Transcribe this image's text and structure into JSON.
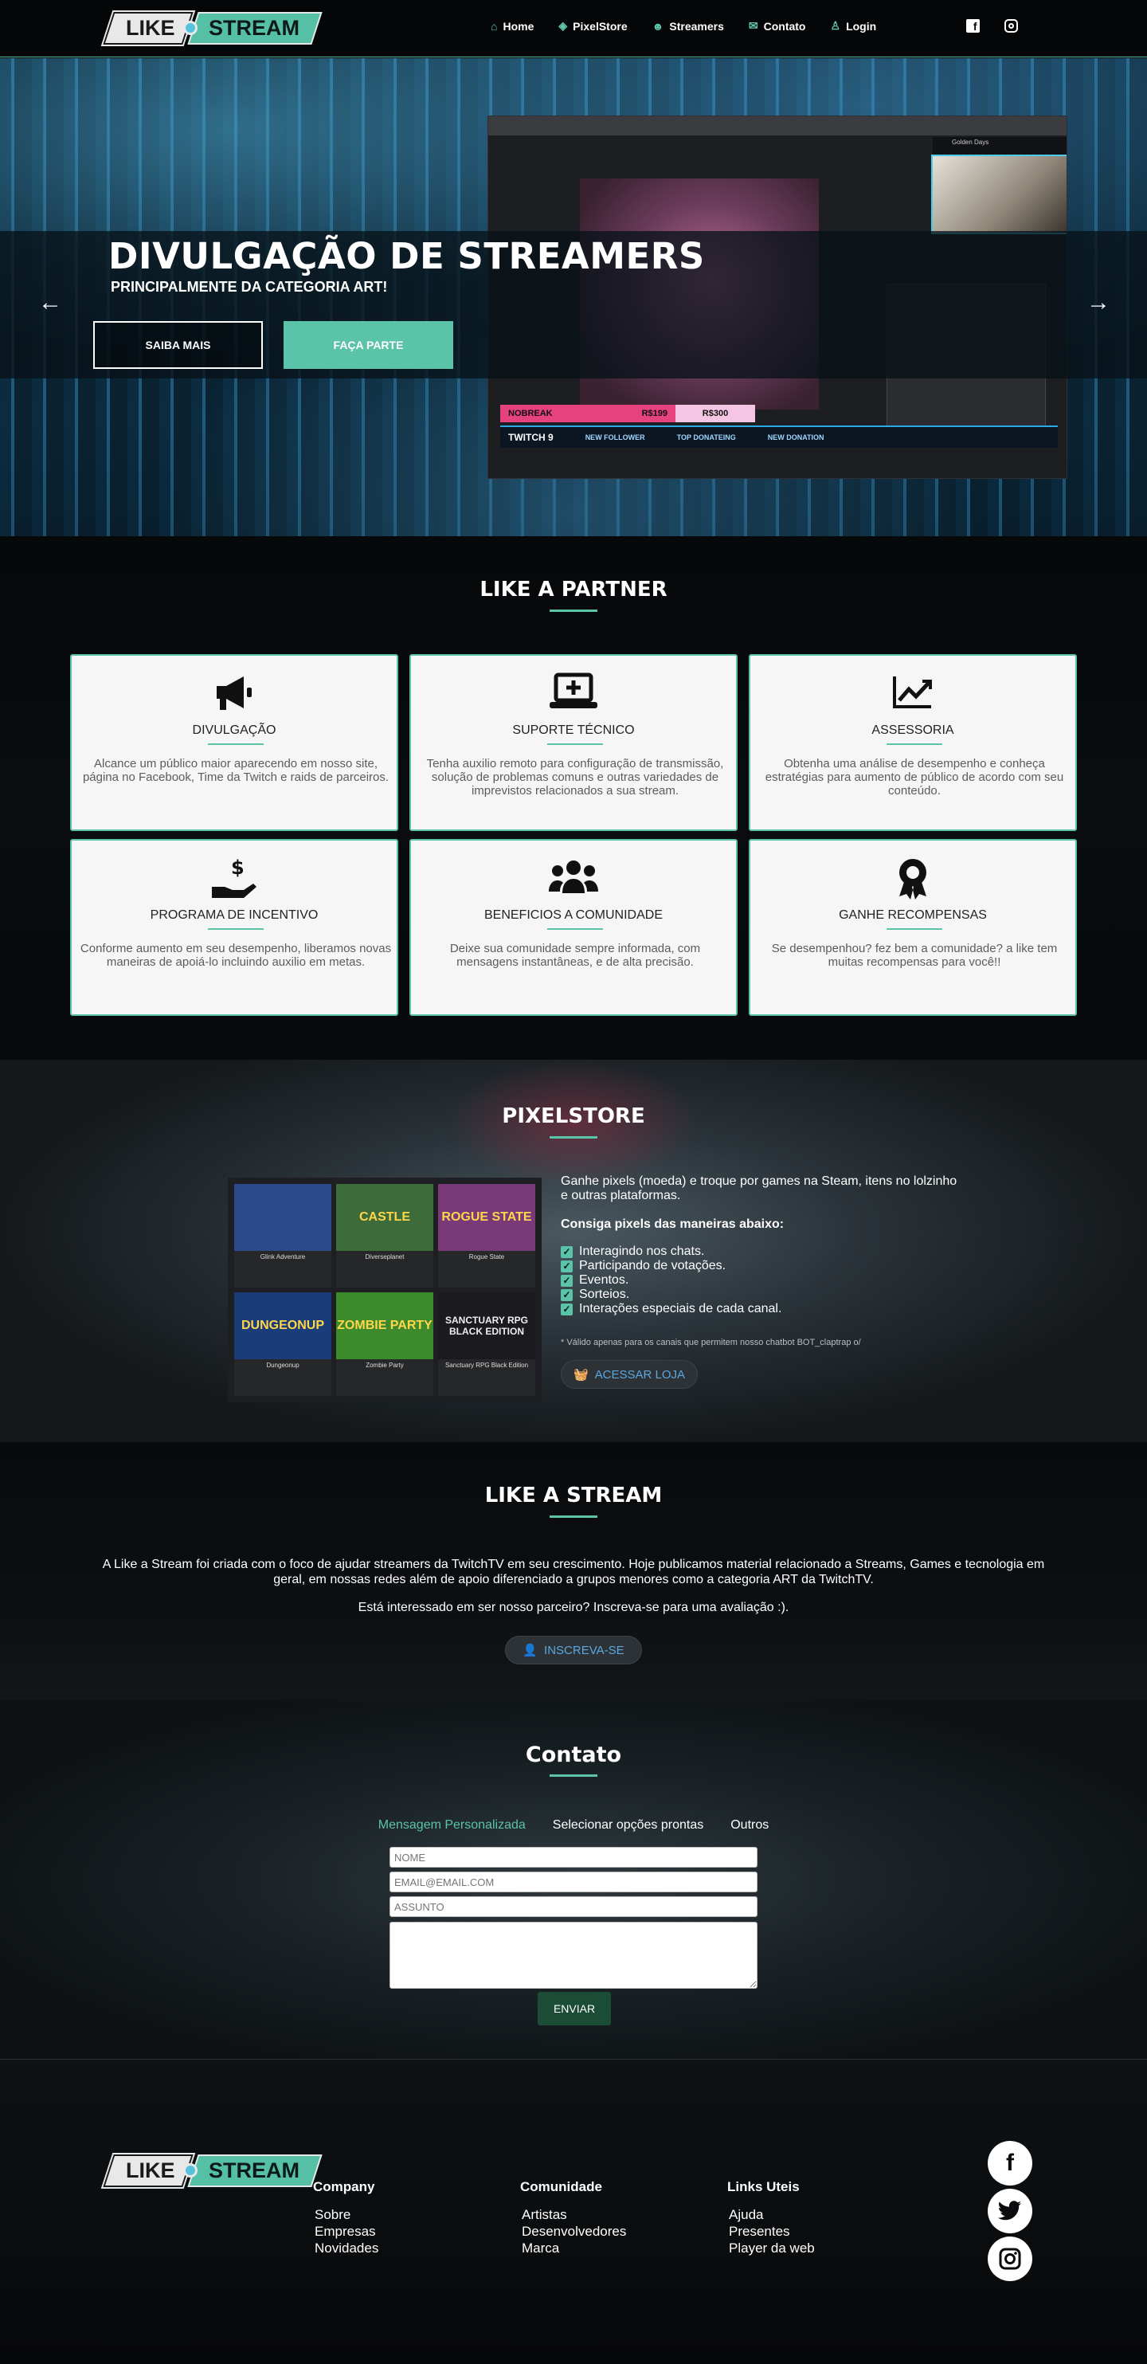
{
  "nav": {
    "logo_like": "LIKE",
    "logo_stream": "STREAM",
    "links": [
      {
        "label": "Home",
        "icon": "home-icon"
      },
      {
        "label": "PixelStore",
        "icon": "coins-icon"
      },
      {
        "label": "Streamers",
        "icon": "users-icon"
      },
      {
        "label": "Contato",
        "icon": "mail-icon"
      },
      {
        "label": "Login",
        "icon": "user-icon"
      }
    ]
  },
  "hero": {
    "title": "DIVULGAÇÃO DE STREAMERS",
    "subtitle": "PRINCIPALMENTE DA CATEGORIA ART!",
    "btn_saiba": "SAIBA MAIS",
    "btn_faca": "FAÇA PARTE",
    "prev_arrow": "←",
    "next_arrow": "→",
    "screen": {
      "nobreak": "NOBREAK",
      "price1": "R$199",
      "price2": "R$300",
      "twitch": "TWITCH",
      "twitch_num": "9",
      "follower": "NEW FOLLOWER",
      "top_donate": "TOP DONATEING",
      "new_donation": "NEW DONATION",
      "cam_label": "Golden Days"
    }
  },
  "partner": {
    "title": "LIKE A PARTNER",
    "cards": [
      {
        "title": "DIVULGAÇÃO",
        "text": "Alcance um público maior aparecendo em nosso site, página no Facebook, Time da Twitch e raids de parceiros."
      },
      {
        "title": "SUPORTE TÉCNICO",
        "text": "Tenha auxilio remoto para configuração de transmissão, solução de problemas comuns e outras variedades de imprevistos relacionados a sua stream."
      },
      {
        "title": "ASSESSORIA",
        "text": "Obtenha uma análise de desempenho e conheça estratégias para aumento de público de acordo com seu conteúdo."
      },
      {
        "title": "PROGRAMA DE INCENTIVO",
        "text": "Conforme aumento em seu desempenho, liberamos novas maneiras de apoiá-lo incluindo auxilio em metas."
      },
      {
        "title": "BENEFICIOS A COMUNIDADE",
        "text": "Deixe sua comunidade sempre informada, com mensagens instantâneas, e de alta precisão."
      },
      {
        "title": "GANHE RECOMPENSAS",
        "text": "Se desempenhou? fez bem a comunidade? a like tem muitas recompensas para você!!"
      }
    ]
  },
  "pixelstore": {
    "title": "PIXELSTORE",
    "intro": "Ganhe pixels (moeda) e troque por games na Steam, itens no lolzinho e outras plataformas.",
    "subhead": "Consiga pixels das maneiras abaixo:",
    "items": [
      "Interagindo nos chats.",
      "Participando de votações.",
      "Eventos.",
      "Sorteios.",
      "Interações especiais de cada canal."
    ],
    "note": "* Válido apenas para os canais que permitem nosso chatbot BOT_claptrap o/",
    "button": "ACESSAR LOJA",
    "games": [
      {
        "name": "Glink Adventure",
        "art": "",
        "color": "#2a4a8a"
      },
      {
        "name": "Diverseplanet",
        "art": "CASTLE",
        "color": "#3d6b3a"
      },
      {
        "name": "Rogue State",
        "art": "ROGUE STATE",
        "color": "#7a3a7a"
      },
      {
        "name": "Dungeonup",
        "art": "DUNGEONUP",
        "color": "#1a3d7a"
      },
      {
        "name": "Zombie Party",
        "art": "ZOMBIE PARTY",
        "color": "#3c8a2c"
      },
      {
        "name": "Sanctuary RPG Black Edition",
        "art": "SANCTUARY RPG BLACK EDITION",
        "color": "#1b1b1f"
      }
    ]
  },
  "likestream": {
    "title": "LIKE A STREAM",
    "para1": "A Like a Stream foi criada com o foco de ajudar streamers da TwitchTV em seu crescimento. Hoje publicamos material relacionado a Streams, Games e tecnologia em geral, em nossas redes além de apoio diferenciado a grupos menores como a categoria ART da TwitchTV.",
    "para2": "Está interessado em ser nosso parceiro? Inscreva-se para uma avaliação :).",
    "button": "INSCREVA-SE"
  },
  "contato": {
    "title": "Contato",
    "tabs": [
      "Mensagem Personalizada",
      "Selecionar opções prontas",
      "Outros"
    ],
    "name_ph": "NOME",
    "email_ph": "EMAIL@EMAIL.COM",
    "subject_ph": "ASSUNTO",
    "send": "ENVIAR"
  },
  "footer": {
    "columns": [
      {
        "head": "Company",
        "links": [
          "Sobre",
          "Empresas",
          "Novidades"
        ]
      },
      {
        "head": "Comunidade",
        "links": [
          "Artistas",
          "Desenvolvedores",
          "Marca"
        ]
      },
      {
        "head": "Links Uteis",
        "links": [
          "Ajuda",
          "Presentes",
          "Player da web"
        ]
      }
    ]
  },
  "colors": {
    "accent": "#5bc3a8",
    "background": "#050607"
  }
}
